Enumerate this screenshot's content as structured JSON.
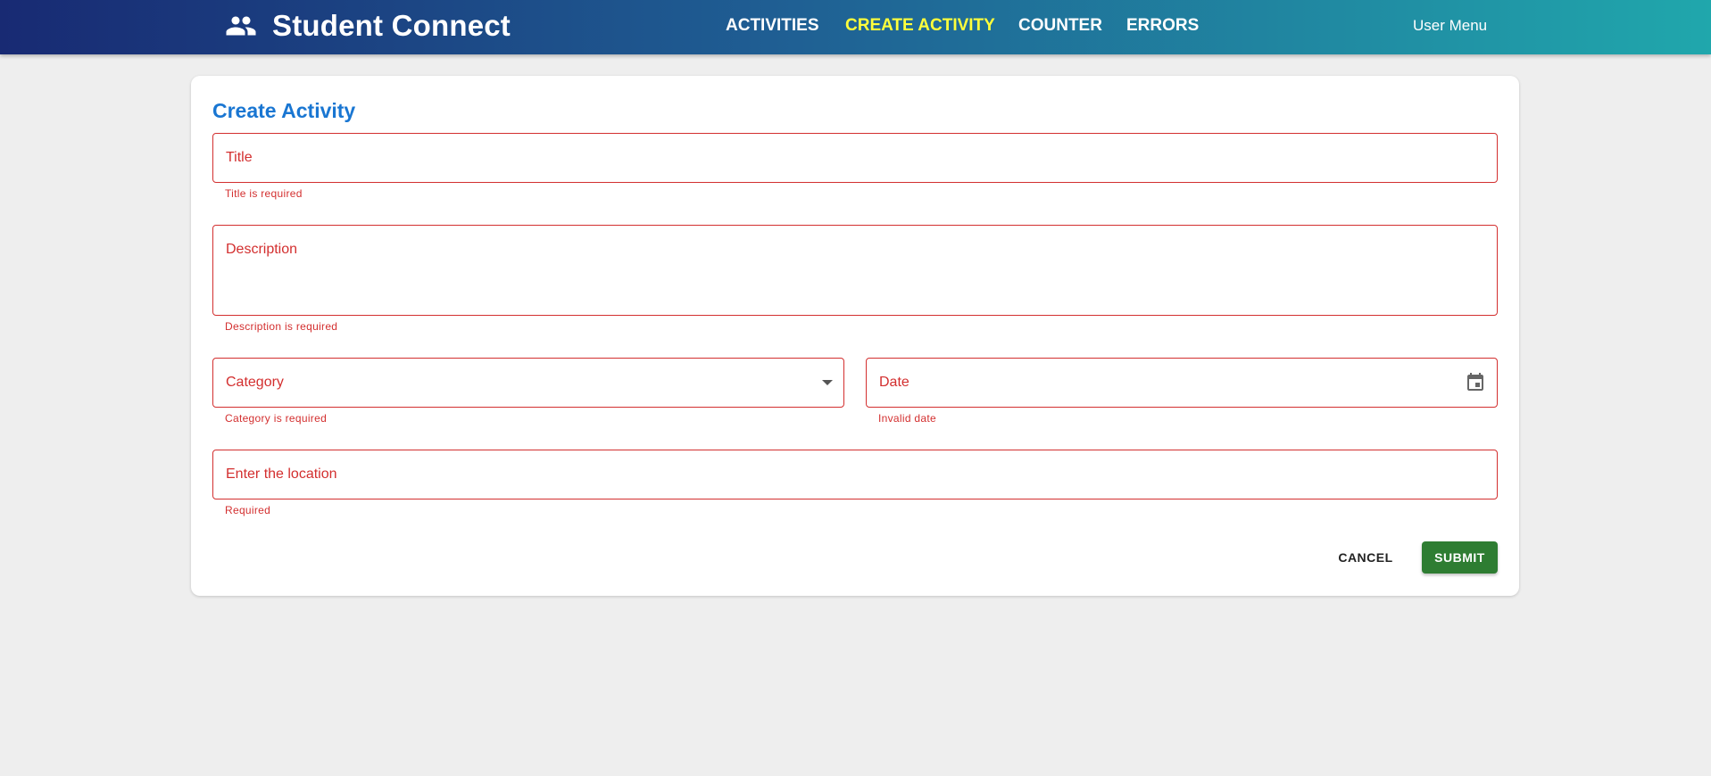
{
  "header": {
    "brand_icon": "group-icon",
    "title": "Student Connect",
    "nav": [
      {
        "label": "ACTIVITIES"
      },
      {
        "label": "CREATE ACTIVITY",
        "active": true
      },
      {
        "label": "COUNTER"
      },
      {
        "label": "ERRORS"
      }
    ],
    "user_menu": "User Menu"
  },
  "form": {
    "title": "Create Activity",
    "fields": {
      "title": {
        "label": "Title",
        "value": "",
        "helper": "Title is required"
      },
      "description": {
        "label": "Description",
        "value": "",
        "helper": "Description is required"
      },
      "category": {
        "label": "Category",
        "value": "",
        "helper": "Category is required"
      },
      "date": {
        "label": "Date",
        "value": "",
        "helper": "Invalid date"
      },
      "location": {
        "label": "Enter the location",
        "value": "",
        "helper": "Required"
      }
    },
    "cancel_label": "CANCEL",
    "submit_label": "SUBMIT"
  },
  "colors": {
    "accent": "#1976d2",
    "error": "#d32f2f",
    "active_nav": "#ffff3b",
    "submit": "#2e7d32",
    "background": "#eeeeee"
  }
}
